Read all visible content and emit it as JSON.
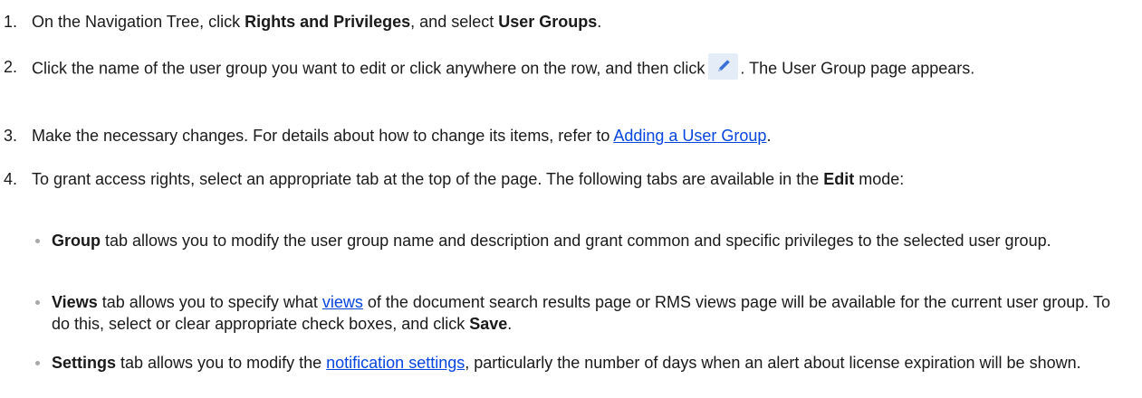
{
  "steps": [
    {
      "number": "1.",
      "text_1": "On the Navigation Tree, click ",
      "bold_1": "Rights and Privileges",
      "text_2": ", and select ",
      "bold_2": "User Groups",
      "text_3": "."
    },
    {
      "number": "2.",
      "text_1": "Click the name of the user group you want to edit or click anywhere on the row, and then click",
      "icon": "edit-pencil-icon",
      "text_2": ". The User Group page appears."
    },
    {
      "number": "3.",
      "text_1": "Make the necessary changes. For details about how to change its items, refer to ",
      "link": "Adding a User Group",
      "text_2": "."
    },
    {
      "number": "4.",
      "text_1": "To grant access rights, select an appropriate tab at the top of the page. The following tabs are available in the ",
      "bold_1": "Edit",
      "text_2": " mode:"
    }
  ],
  "tabs": [
    {
      "bold": "Group",
      "text": " tab allows you to modify the user group name and description and grant common and specific privileges to the selected user group."
    },
    {
      "bold": "Views",
      "text_1": " tab allows you to specify what ",
      "link": "views",
      "text_2": " of the document search results page or RMS views page will be available for the current user group. To do this, select or clear appropriate check boxes, and click ",
      "bold_2": "Save",
      "text_3": "."
    },
    {
      "bold": "Settings",
      "text_1": " tab allows you to modify the ",
      "link": "notification settings",
      "text_2": ", particularly the number of days when an alert about license expiration will be shown."
    }
  ],
  "colors": {
    "link": "#0645e0",
    "bullet": "#a8a8a8",
    "icon_bg": "#e4edf7",
    "icon_pencil": "#3a6fd8"
  }
}
